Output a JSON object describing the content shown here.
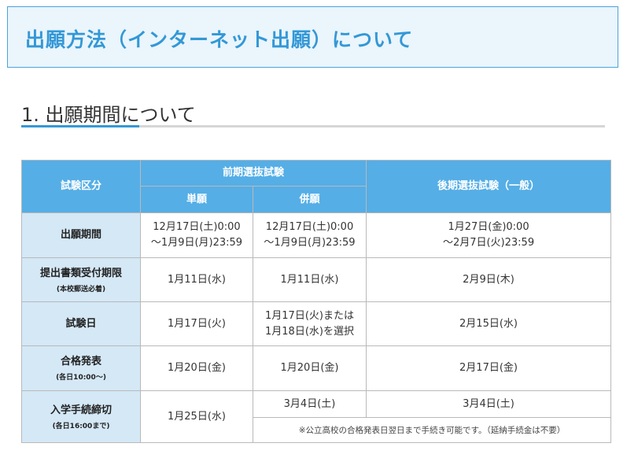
{
  "page": {
    "title": "出願方法（インターネット出願）について",
    "section_heading": "1. 出願期間について"
  },
  "table": {
    "headers": {
      "category": "試験区分",
      "early": "前期選抜試験",
      "single": "単願",
      "combined": "併願",
      "late": "後期選抜試験（一般）"
    },
    "rows": [
      {
        "label": "出願期間",
        "sub": "",
        "single": [
          "12月17日(土)0:00",
          "～1月9日(月)23:59"
        ],
        "combined": [
          "12月17日(土)0:00",
          "～1月9日(月)23:59"
        ],
        "late": [
          "1月27日(金)0:00",
          "～2月7日(火)23:59"
        ]
      },
      {
        "label": "提出書類受付期限",
        "sub": "(本校郵送必着)",
        "single": [
          "1月11日(水)"
        ],
        "combined": [
          "1月11日(水)"
        ],
        "late": [
          "2月9日(木)"
        ]
      },
      {
        "label": "試験日",
        "sub": "",
        "single": [
          "1月17日(火)"
        ],
        "combined": [
          "1月17日(火)または",
          "1月18日(水)を選択"
        ],
        "late": [
          "2月15日(水)"
        ]
      },
      {
        "label": "合格発表",
        "sub": "(各日10:00～)",
        "single": [
          "1月20日(金)"
        ],
        "combined": [
          "1月20日(金)"
        ],
        "late": [
          "2月17日(金)"
        ]
      },
      {
        "label": "入学手続締切",
        "sub": "(各日16:00まで)",
        "single": [
          "1月25日(水)"
        ],
        "combined": [
          "3月4日(土)"
        ],
        "late": [
          "3月4日(土)"
        ],
        "note": "※公立高校の合格発表日翌日まで手続き可能です。（延納手続金は不要）"
      }
    ]
  },
  "colors": {
    "accent": "#3398d6",
    "header_bg": "#55aee6",
    "row_header_bg": "#d4e8f6",
    "title_bg": "#eaf5fc"
  }
}
